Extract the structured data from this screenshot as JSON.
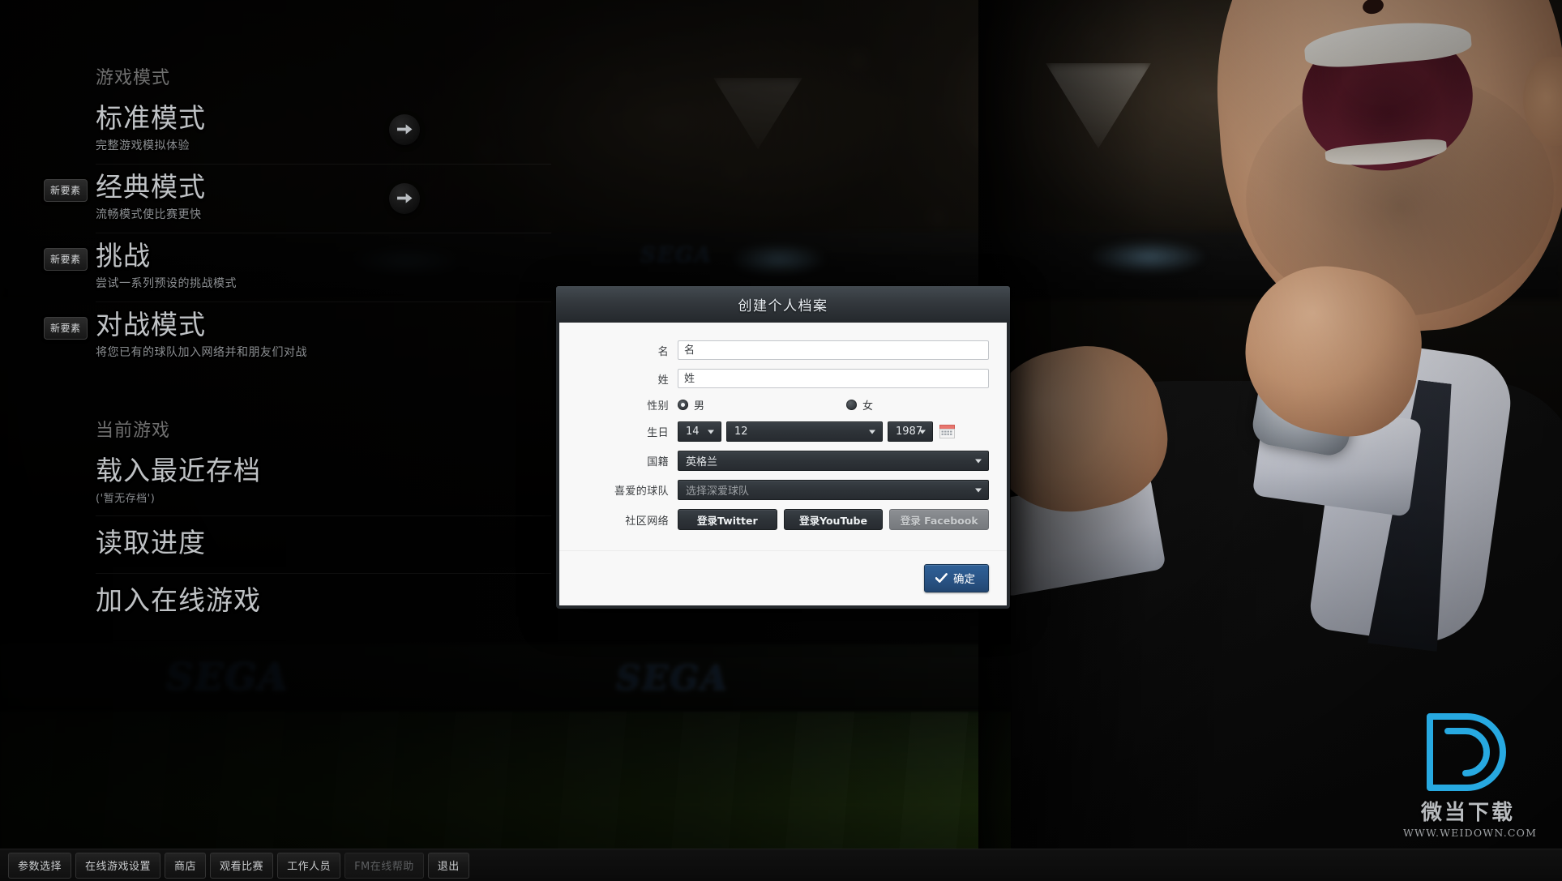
{
  "background": {
    "sega_label": "SEGA"
  },
  "menu": {
    "sections": [
      {
        "title": "游戏模式",
        "items": [
          {
            "title": "标准模式",
            "sub": "完整游戏模拟体验",
            "badge": "",
            "arrow": true
          },
          {
            "title": "经典模式",
            "sub": "流畅模式使比赛更快",
            "badge": "新要素",
            "arrow": true
          },
          {
            "title": "挑战",
            "sub": "尝试一系列预设的挑战模式",
            "badge": "新要素",
            "arrow": false
          },
          {
            "title": "对战模式",
            "sub": "将您已有的球队加入网络并和朋友们对战",
            "badge": "新要素",
            "arrow": false
          }
        ]
      },
      {
        "title": "当前游戏",
        "items": [
          {
            "title": "载入最近存档",
            "sub": "('暂无存档')",
            "badge": "",
            "arrow": false
          },
          {
            "title": "读取进度",
            "sub": "",
            "badge": "",
            "arrow": false
          },
          {
            "title": "加入在线游戏",
            "sub": "",
            "badge": "",
            "arrow": false
          }
        ]
      }
    ]
  },
  "toolbar": {
    "buttons": [
      {
        "label": "参数选择",
        "disabled": false
      },
      {
        "label": "在线游戏设置",
        "disabled": false
      },
      {
        "label": "商店",
        "disabled": false
      },
      {
        "label": "观看比赛",
        "disabled": false
      },
      {
        "label": "工作人员",
        "disabled": false
      },
      {
        "label": "FM在线帮助",
        "disabled": true
      },
      {
        "label": "退出",
        "disabled": false
      }
    ]
  },
  "dialog": {
    "title": "创建个人档案",
    "fields": {
      "first_name": {
        "label": "名",
        "value": "",
        "placeholder": "名"
      },
      "last_name": {
        "label": "姓",
        "value": "",
        "placeholder": "姓"
      },
      "gender": {
        "label": "性别",
        "options": [
          {
            "label": "男",
            "selected": true
          },
          {
            "label": "女",
            "selected": false
          }
        ]
      },
      "birthday": {
        "label": "生日",
        "day": "14",
        "month": "12",
        "year": "1987",
        "calendar_icon": "calendar-icon"
      },
      "nationality": {
        "label": "国籍",
        "value": "英格兰"
      },
      "favourite_team": {
        "label": "喜爱的球队",
        "value": "选择深爱球队",
        "is_placeholder": true
      },
      "social": {
        "label": "社区网络",
        "buttons": [
          {
            "label": "登录Twitter",
            "disabled": false
          },
          {
            "label": "登录YouTube",
            "disabled": false
          },
          {
            "label": "登录 Facebook",
            "disabled": true
          }
        ]
      }
    },
    "confirm_button": {
      "label": "确定",
      "icon": "check-icon"
    }
  },
  "watermark": {
    "logo_letter": "D",
    "name_cn": "微当下载",
    "url": "WWW.WEIDOWN.COM",
    "color": "#27a9e1"
  }
}
